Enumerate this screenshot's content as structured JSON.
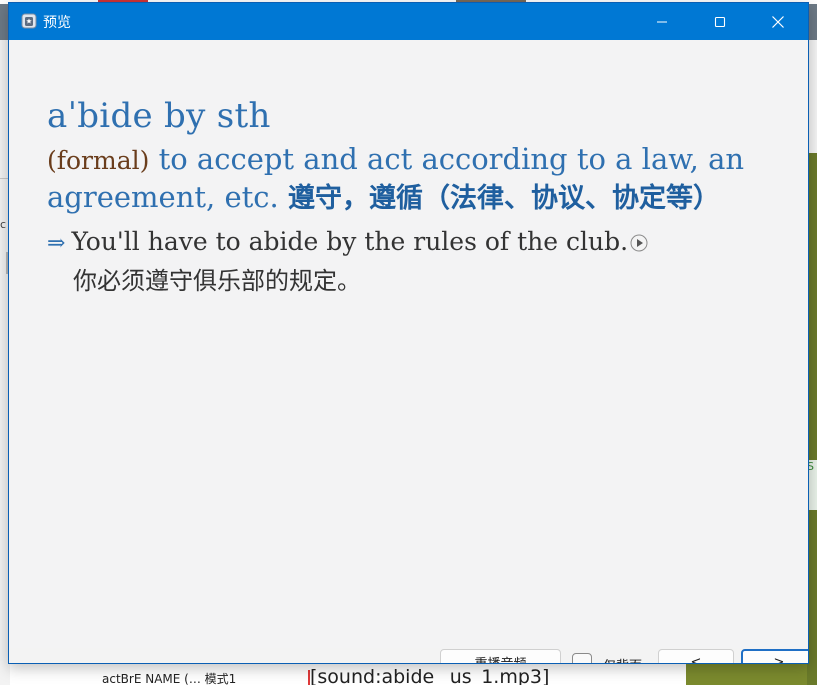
{
  "window": {
    "title": "预览",
    "accent_color": "#0078d4"
  },
  "entry": {
    "headword": "aˈbide by sth",
    "register": "(formal)",
    "definition_en": "to accept and act according to a law, an agreement, etc.",
    "definition_cn": "遵守，遵循（法律、协议、协定等）",
    "example_arrow": "⇒",
    "example_en": "You'll have to abide by the rules of the club.",
    "example_cn": "你必须遵守俱乐部的规定。",
    "headword_color": "#2f70b0",
    "register_color": "#6a3d1c"
  },
  "controls": {
    "replay_label": "重播音频",
    "back_only_label": "仅背面",
    "back_only_checked": false,
    "prev_label": "<",
    "next_label": ">"
  },
  "background": {
    "left_fragment": "c",
    "right_fragment": "S",
    "bottom_left_text": "actBrE NAME (…  模式1",
    "bottom_mid_text": "[sound:abide _us_1.mp3]"
  },
  "icons": {
    "app": "anki-app-icon",
    "minimize": "minimize-icon",
    "maximize": "maximize-icon",
    "close": "close-icon",
    "play": "play-audio-icon"
  }
}
